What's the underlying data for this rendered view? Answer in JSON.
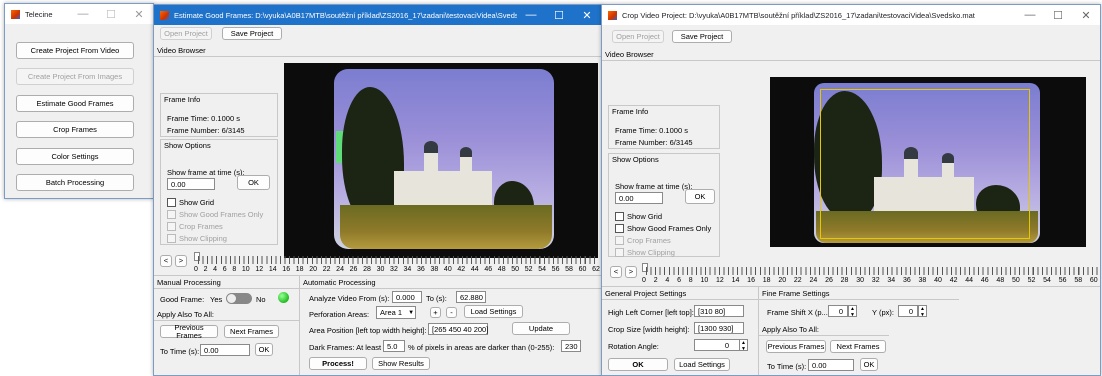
{
  "telecine": {
    "title": "Telecine",
    "buttons": [
      {
        "label": "Create Project From Video",
        "disabled": false
      },
      {
        "label": "Create Project From Images",
        "disabled": true
      },
      {
        "label": "Estimate Good Frames",
        "disabled": false
      },
      {
        "label": "Crop Frames",
        "disabled": false
      },
      {
        "label": "Color Settings",
        "disabled": false
      },
      {
        "label": "Batch Processing",
        "disabled": false
      }
    ]
  },
  "window_controls": {
    "minimize": "—",
    "maximize": "☐",
    "close": "✕"
  },
  "estimate": {
    "title": "Estimate Good Frames: D:\\vyuka\\A0B17MTB\\soutěžní příklad\\ZS2016_17\\zadani\\testovaciVidea\\Svedsko.mat",
    "open_project": "Open Project",
    "save_project": "Save Project",
    "video_browser": "Video Browser",
    "frame_info": "Frame Info",
    "frame_time": "Frame Time: 0.1000 s",
    "frame_number": "Frame Number: 6/3145",
    "show_options": "Show Options",
    "show_frame_at_time": "Show frame at time (s):",
    "time_value": "0.00",
    "ok": "OK",
    "show_grid": "Show Grid",
    "show_good_frames_only": "Show Good Frames Only",
    "crop_frames": "Crop Frames",
    "show_clipping": "Show Clipping",
    "slider_prev": "<",
    "slider_next": ">",
    "ticks": [
      "0",
      "2",
      "4",
      "6",
      "8",
      "10",
      "12",
      "14",
      "16",
      "18",
      "20",
      "22",
      "24",
      "26",
      "28",
      "30",
      "32",
      "34",
      "36",
      "38",
      "40",
      "42",
      "44",
      "46",
      "48",
      "50",
      "52",
      "54",
      "56",
      "58",
      "60",
      "62"
    ],
    "manual_processing": "Manual Processing",
    "good_frame": "Good Frame:",
    "yes": "Yes",
    "no": "No",
    "apply_also_to_all": "Apply Also To All:",
    "previous_frames": "Previous Frames",
    "next_frames": "Next Frames",
    "to_time": "To Time (s):",
    "to_time_value": "0.00",
    "automatic_processing": "Automatic Processing",
    "analyze_from": "Analyze Video From (s):",
    "analyze_from_value": "0.000",
    "to_s": "To (s):",
    "to_s_value": "62.880",
    "perforation_areas": "Perforation Areas:",
    "area_select": "Area 1",
    "plus": "+",
    "minus": "-",
    "load_settings": "Load Settings",
    "area_position": "Area Position [left top width height]:",
    "area_position_value": "[265 450 40 200]",
    "update": "Update",
    "dark_frames": "Dark Frames: At least",
    "dark_percent": "5.0",
    "dark_text": "% of pixels in areas are darker than (0-255):",
    "dark_value": "230",
    "process": "Process!",
    "show_results": "Show Results"
  },
  "crop": {
    "title": "Crop Video Project: D:\\vyuka\\A0B17MTB\\soutěžní příklad\\ZS2016_17\\zadani\\testovaciVidea\\Svedsko.mat",
    "open_project": "Open Project",
    "save_project": "Save Project",
    "video_browser": "Video Browser",
    "frame_info": "Frame Info",
    "frame_time": "Frame Time: 0.1000 s",
    "frame_number": "Frame Number: 6/3145",
    "show_options": "Show Options",
    "show_frame_at_time": "Show frame at time (s):",
    "time_value": "0.00",
    "ok": "OK",
    "show_grid": "Show Grid",
    "show_good_frames_only": "Show Good Frames Only",
    "crop_frames": "Crop Frames",
    "show_clipping": "Show Clipping",
    "slider_prev": "<",
    "slider_next": ">",
    "ticks": [
      "0",
      "2",
      "4",
      "6",
      "8",
      "10",
      "12",
      "14",
      "16",
      "18",
      "20",
      "22",
      "24",
      "26",
      "28",
      "30",
      "32",
      "34",
      "36",
      "38",
      "40",
      "42",
      "44",
      "46",
      "48",
      "50",
      "52",
      "54",
      "56",
      "58",
      "60"
    ],
    "general_settings": "General Project Settings",
    "high_left_corner": "High Left Corner [left top]:",
    "high_left_value": "[310 80]",
    "crop_size": "Crop Size [width height]:",
    "crop_size_value": "[1300 930]",
    "rotation_angle": "Rotation Angle:",
    "rotation_value": "0",
    "ok_bold": "OK",
    "load_settings": "Load Settings",
    "fine_settings": "Fine Frame Settings",
    "shift_x": "Frame Shift X (p...",
    "shift_x_value": "0",
    "shift_y": "Y (px):",
    "shift_y_value": "0",
    "apply_also_to_all": "Apply Also To All:",
    "previous_frames": "Previous Frames",
    "next_frames": "Next Frames",
    "to_time": "To Time (s):",
    "to_time_value": "0.00",
    "ok2": "OK"
  },
  "colors": {
    "accent": "#1f72c9",
    "toggle_on": "#2fc82f"
  }
}
